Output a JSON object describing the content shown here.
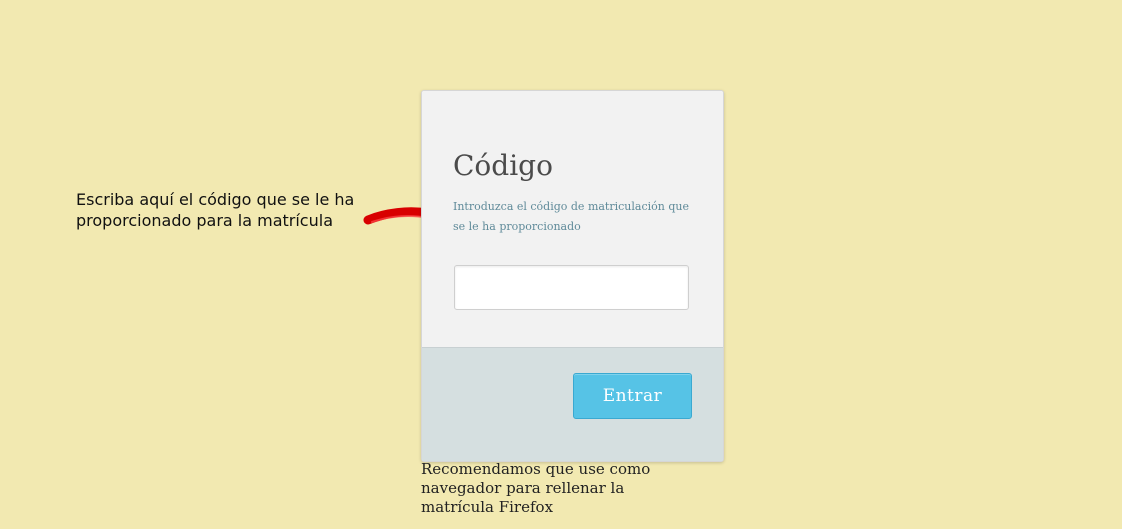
{
  "callout": {
    "text": "Escriba aquí el código que se le ha proporcionado para la matrícula"
  },
  "form": {
    "title": "Código",
    "description": "Introduzca el código de matriculación que se le ha proporcionado",
    "code_input": {
      "value": "",
      "placeholder": ""
    },
    "submit_label": "Entrar"
  },
  "footnote": {
    "text": "Recomendamos que use como navegador para rellenar la matrícula Firefox"
  },
  "colors": {
    "page_background": "#f2e9b1",
    "card_top": "#f2f2f2",
    "card_bottom": "#d5dfe0",
    "button": "#56c3e6",
    "arrow": "#e00000"
  },
  "icons": {
    "arrow": "red-arrow-icon"
  }
}
